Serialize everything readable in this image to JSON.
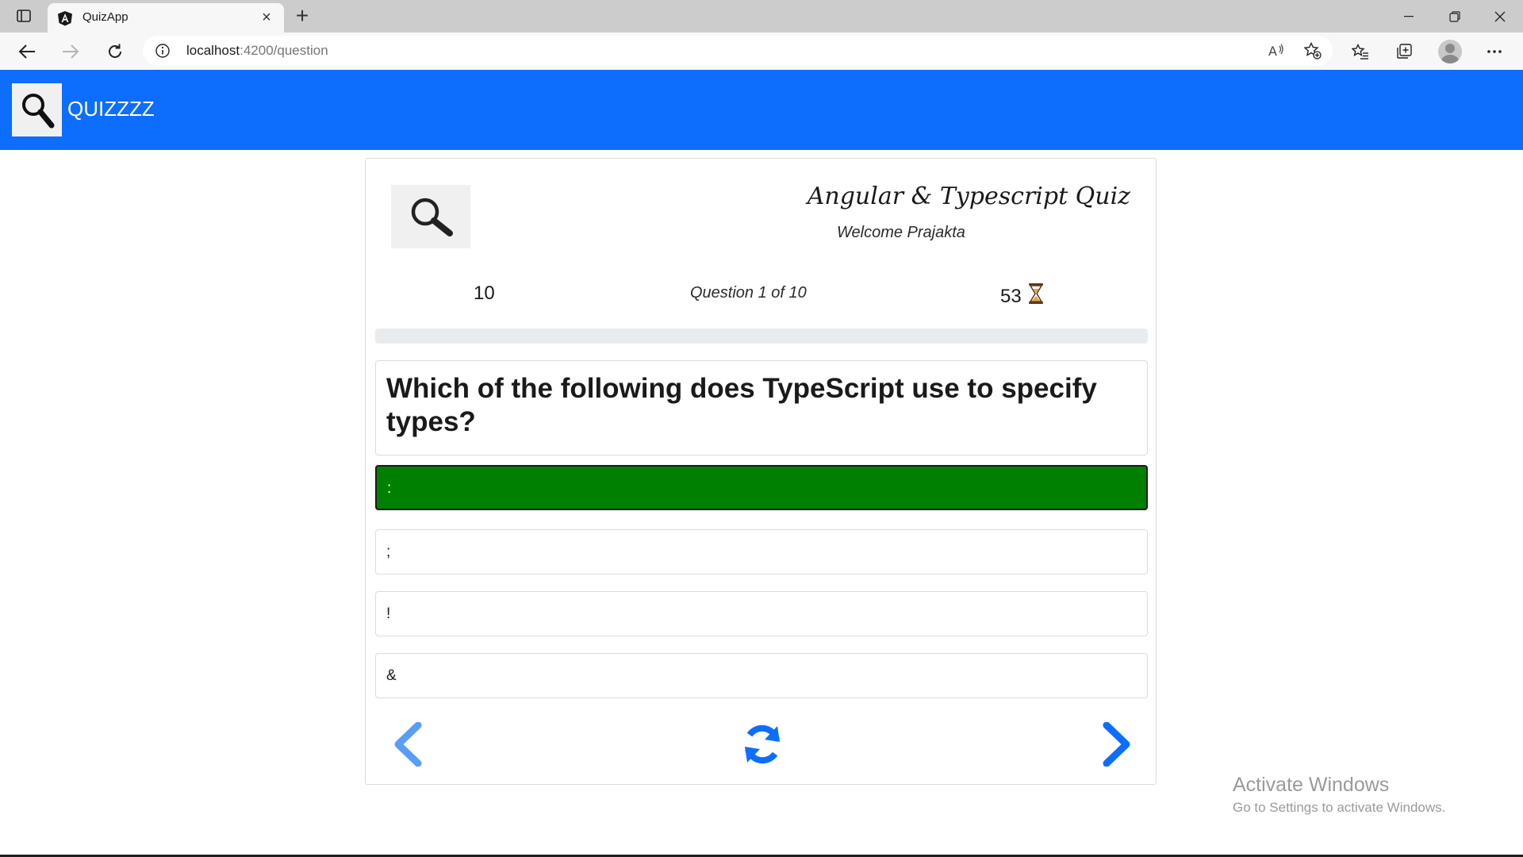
{
  "browser": {
    "tab_title": "QuizApp",
    "url_host": "localhost",
    "url_path": ":4200/question"
  },
  "navbar": {
    "brand": "QUIZZZZ",
    "background": "#0d6efd"
  },
  "quiz": {
    "title": "Angular & Typescript Quiz",
    "welcome": "Welcome Prajakta",
    "points": "10",
    "progress_text": "Question 1 of 10",
    "timer": "53",
    "progress_fraction": 0.0,
    "question": "Which of the following does TypeScript use to specify types?",
    "options": [
      {
        "label": ":",
        "selected": true
      },
      {
        "label": ";",
        "selected": false
      },
      {
        "label": "!",
        "selected": false
      },
      {
        "label": "&",
        "selected": false
      }
    ],
    "selected_color": "#008000",
    "icons": {
      "logo": "magnifier-icon",
      "timer": "hourglass-icon",
      "prev": "chevron-left-icon",
      "reset": "refresh-icon",
      "next": "chevron-right-icon"
    }
  },
  "watermark": {
    "title": "Activate Windows",
    "subtitle": "Go to Settings to activate Windows."
  }
}
